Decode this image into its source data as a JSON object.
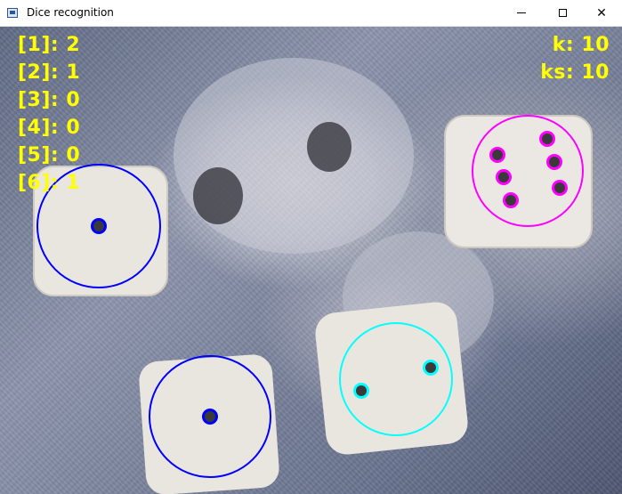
{
  "window": {
    "title": "Dice recognition",
    "minimize_glyph": "",
    "maximize_glyph": "",
    "close_glyph": "✕"
  },
  "counts": [
    {
      "label": "[1]: 2"
    },
    {
      "label": "[2]: 1"
    },
    {
      "label": "[3]: 0"
    },
    {
      "label": "[4]: 0"
    },
    {
      "label": "[5]: 0"
    },
    {
      "label": "[6]: 1"
    }
  ],
  "stats": {
    "k": "k: 10",
    "ks": "ks: 10"
  },
  "colors": {
    "text_yellow": "#ffff00",
    "die_one": "#0000ff",
    "die_two": "#00ffff",
    "die_six": "#ff00ff"
  }
}
